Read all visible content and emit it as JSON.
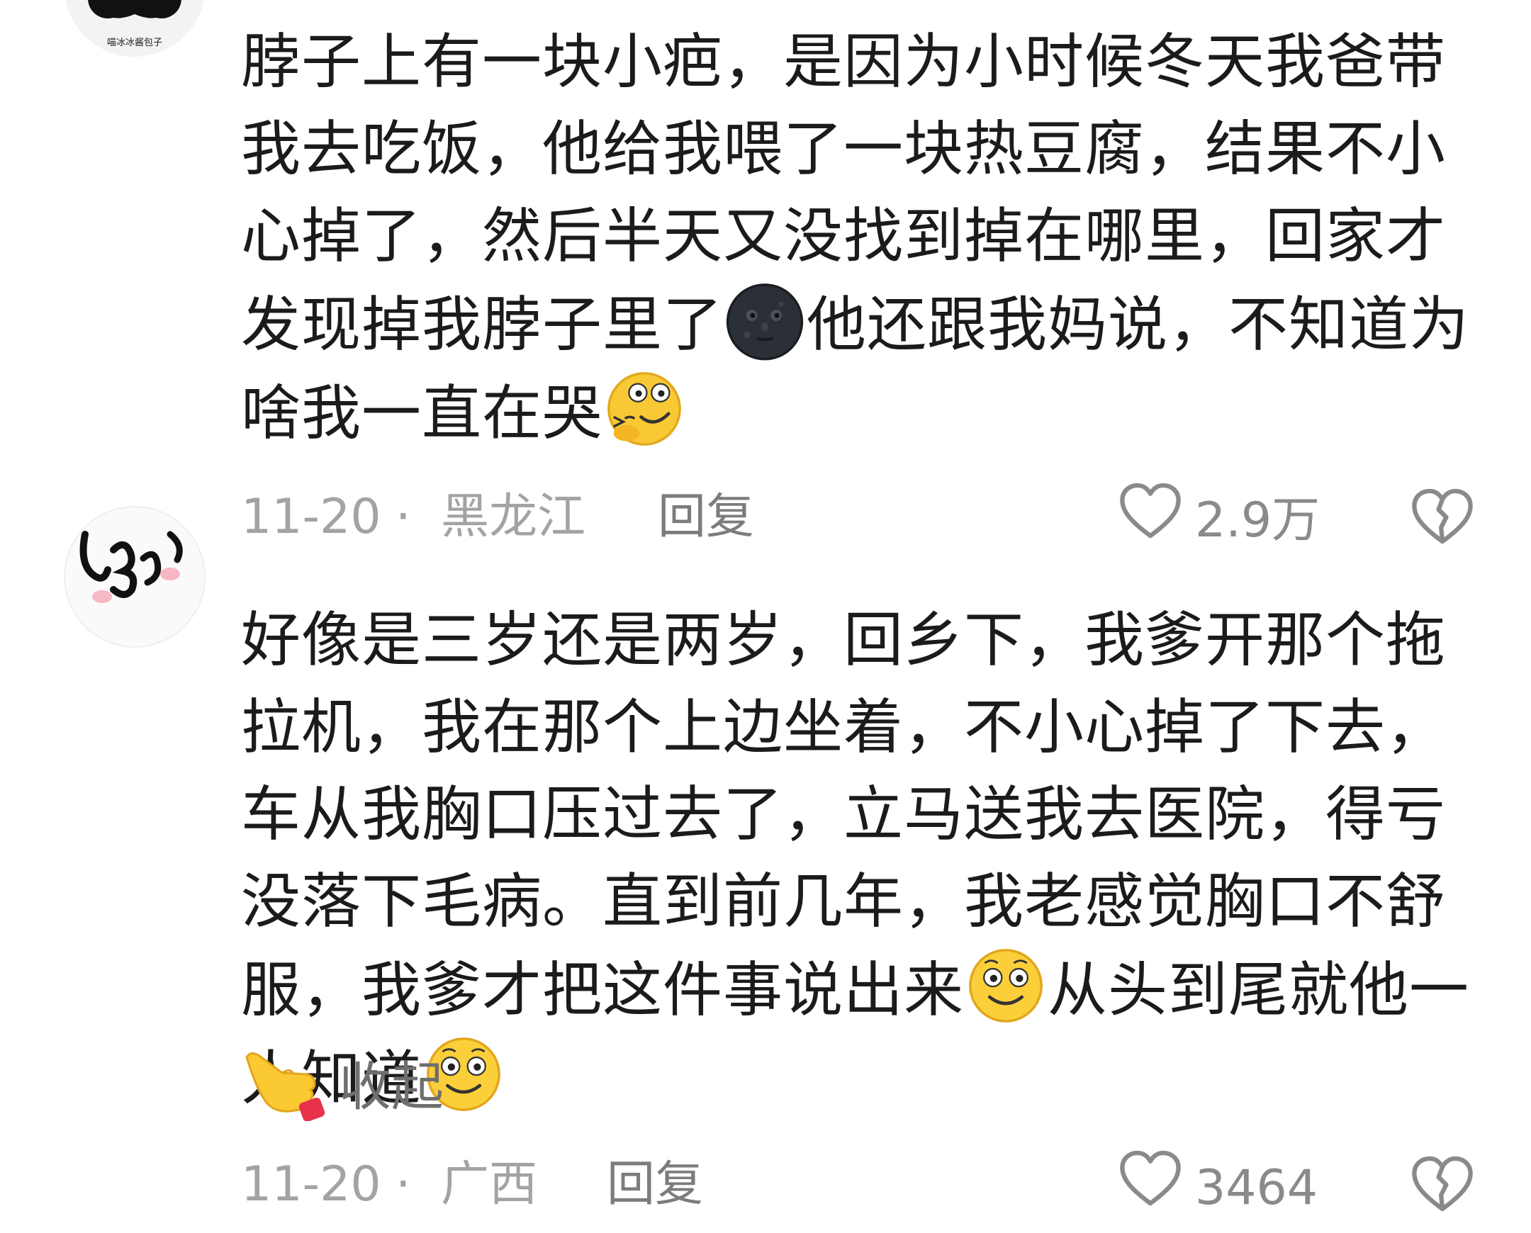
{
  "comments": [
    {
      "avatar_caption": "喵冰冰酱包子",
      "text_parts": [
        "脖子上有一块小疤，是因为小时候冬天我爸带我去吃饭，他给我喂了一块热豆腐，结果不小心掉了，然后半天又没找到掉在哪里，回家才发现掉我脖子里了",
        "他还跟我妈说，不知道为啥我一直在哭"
      ],
      "emojis": [
        "dark-moon-face-icon",
        "laughing-tears-emoji-icon"
      ],
      "date": "11-20",
      "separator": "·",
      "location": "黑龙江",
      "reply_label": "回复",
      "like_count": "2.9万"
    },
    {
      "text_parts": [
        "好像是三岁还是两岁，回乡下，我爹开那个拖拉机，我在那个上边坐着，不小心掉了下去，车从我胸口压过去了，立马送我去医院，得亏没落下毛病。直到前几年，我老感觉胸口不舒服，我爹才把这件事说出来",
        "从头到尾就他一人知道"
      ],
      "emojis": [
        "smile-emoji-icon",
        "smile-emoji-icon"
      ],
      "collapse_label": "收起",
      "date": "11-20",
      "separator": "·",
      "location": "广西",
      "reply_label": "回复",
      "like_count": "3464"
    }
  ],
  "colors": {
    "text": "#1b1b1b",
    "meta": "#a3a3a3",
    "reply": "#7c7c7c"
  }
}
